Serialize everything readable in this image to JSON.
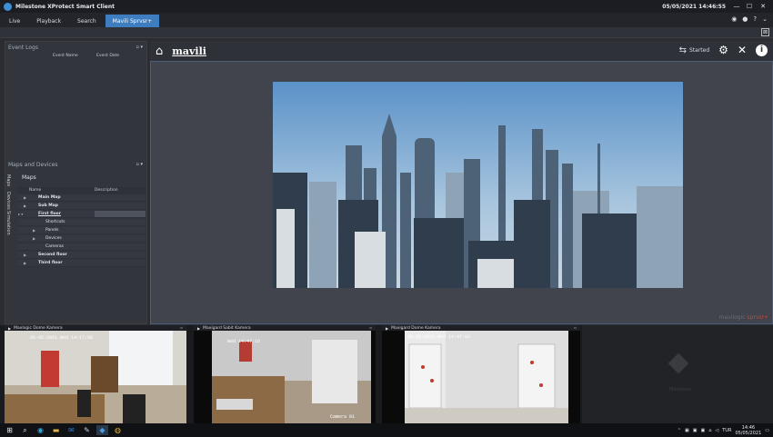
{
  "window": {
    "title": "Milestone XProtect Smart Client",
    "datetime": "05/05/2021 14:46:55"
  },
  "tabs": [
    {
      "label": "Live"
    },
    {
      "label": "Playback"
    },
    {
      "label": "Search"
    },
    {
      "label": "Mavili Sprvsr+"
    }
  ],
  "left_panel": {
    "event_logs": {
      "title": "Event Logs",
      "col_event_name": "Event Name",
      "col_event_date": "Event Date"
    },
    "maps_devices": {
      "title": "Maps and Devices",
      "vtabs": [
        "Maps",
        "Devices",
        "Simulation"
      ],
      "maps_title": "Maps",
      "col_name": "Name",
      "col_description": "Description",
      "items": [
        {
          "label": "Main Map"
        },
        {
          "label": "Sub Map"
        },
        {
          "label": "First floor"
        },
        {
          "label": "Shortcuts"
        },
        {
          "label": "Panels"
        },
        {
          "label": "Devices"
        },
        {
          "label": "Cameras"
        },
        {
          "label": "Second floor"
        },
        {
          "label": "Third floor"
        }
      ]
    }
  },
  "main": {
    "brand": "mavili",
    "status": "Started",
    "footer_brand_prefix": "mavilogic ",
    "footer_brand_suffix": "sprvsr+"
  },
  "cameras": [
    {
      "title": "Maxlogic Dome Kamera",
      "stamp": "05-05-2021 Wed 14:17:58",
      "label": ""
    },
    {
      "title": "Maxigard Sabit Kamera",
      "stamp": "Wed 14:47:16",
      "label": "Camera 01"
    },
    {
      "title": "Maxigard Dome Kamera",
      "stamp": "05-05-2021 Wed 14:47:02",
      "label": ""
    },
    {
      "title": "",
      "stamp": "",
      "label": "Milestone"
    }
  ],
  "taskbar": {
    "language": "TUR",
    "time": "14:46",
    "date": "05/05/2021"
  }
}
